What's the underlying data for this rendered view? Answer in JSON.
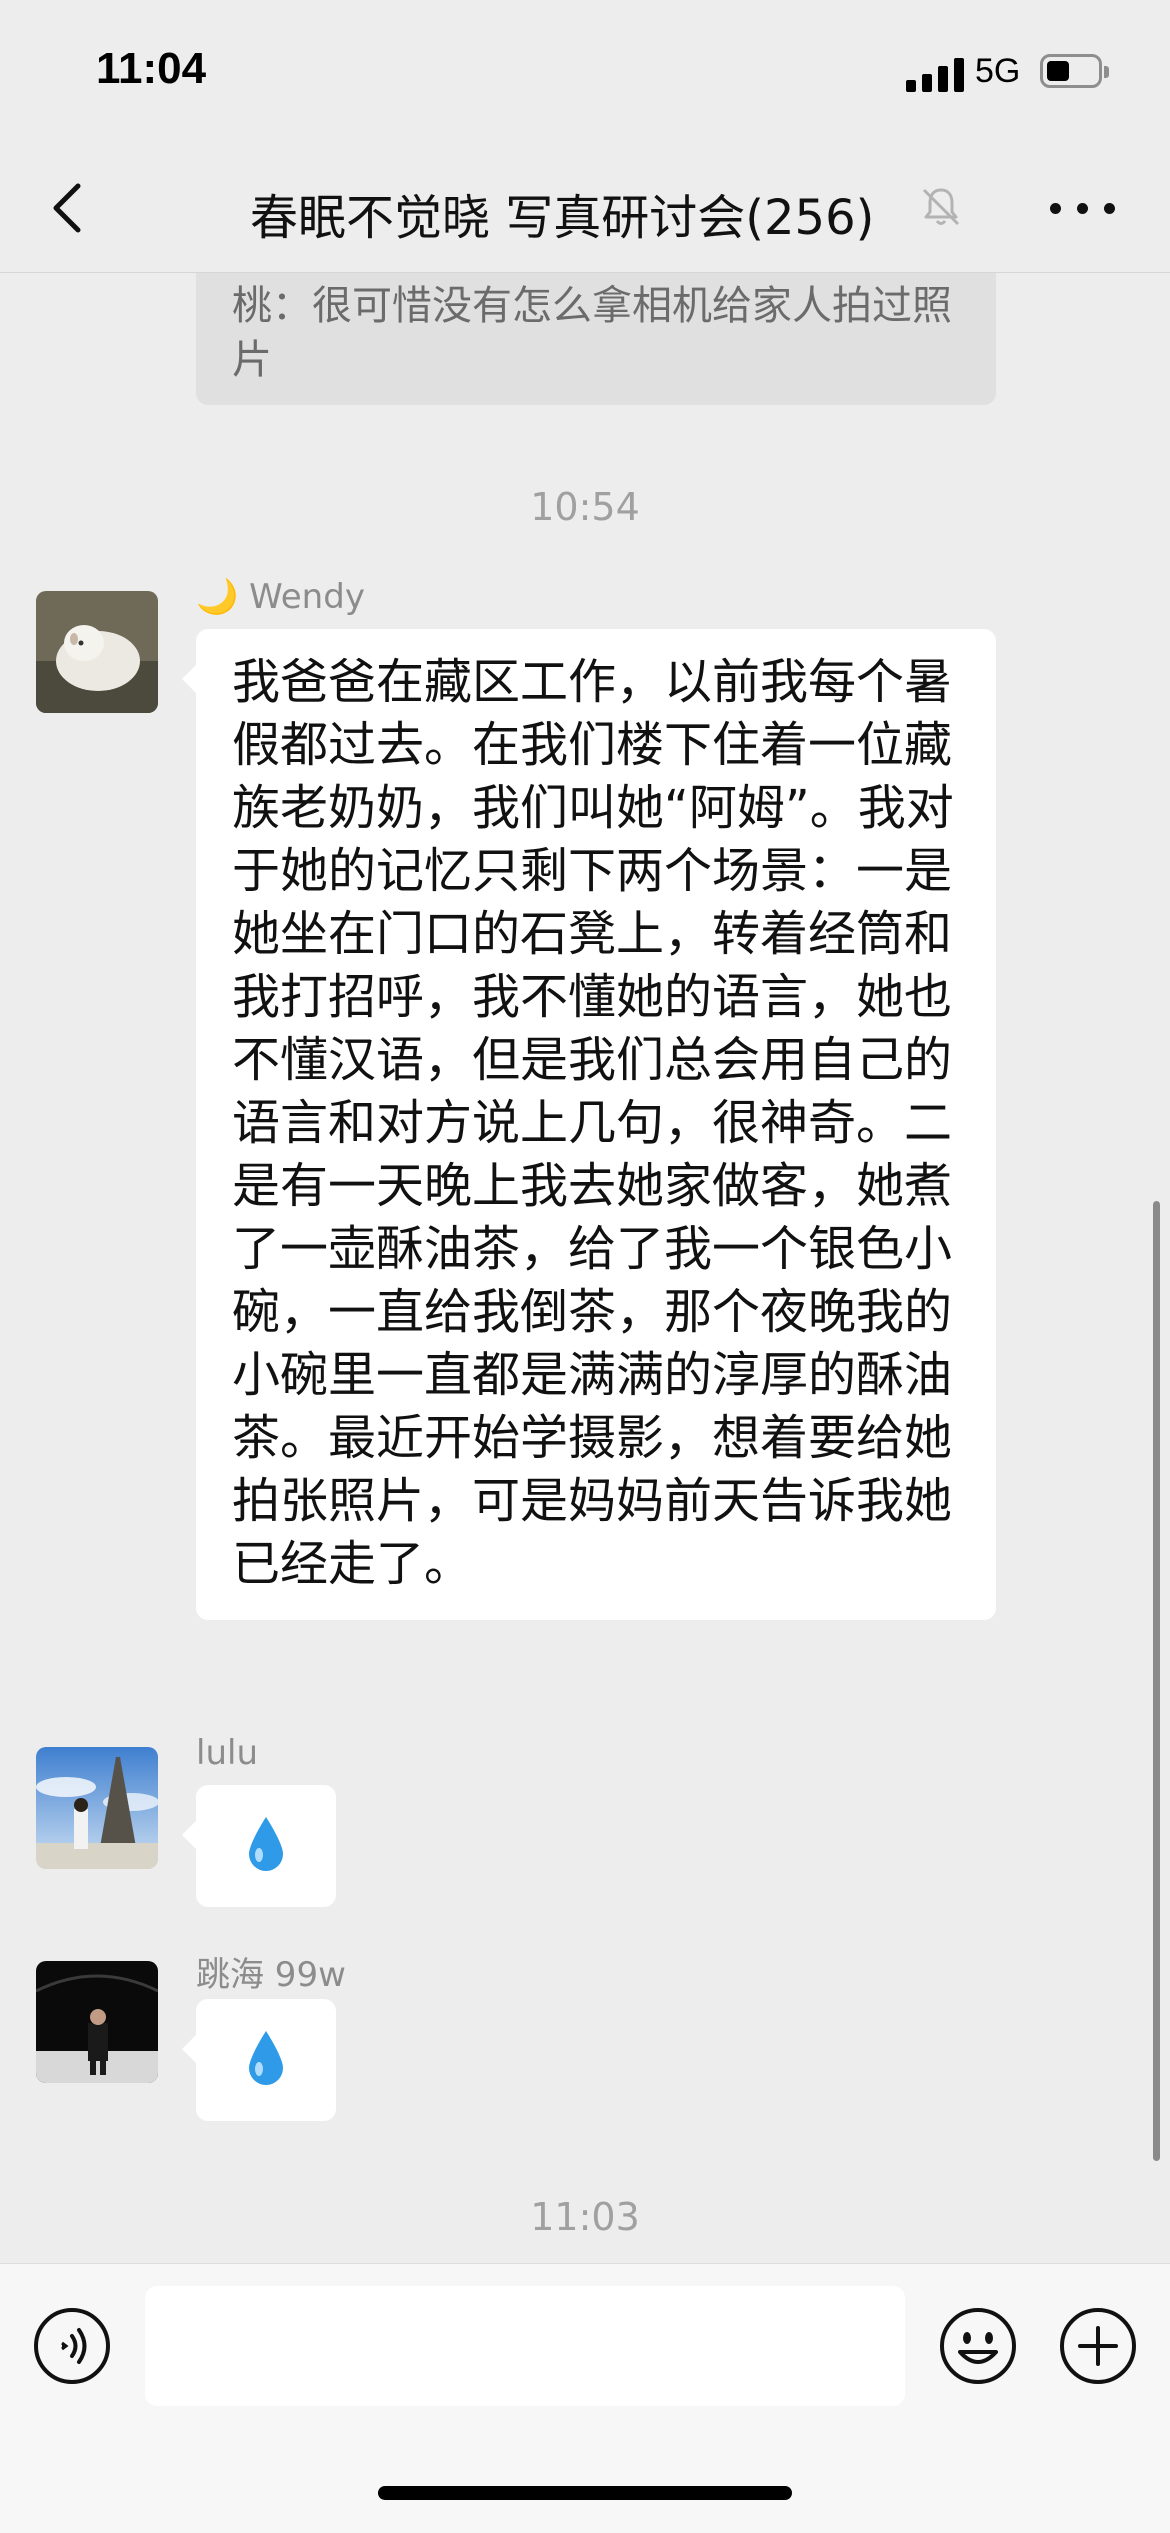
{
  "status_bar": {
    "time": "11:04",
    "network": "5G",
    "icons": [
      "signal-icon",
      "battery-icon"
    ]
  },
  "header": {
    "title": "春眠不觉晓 写真研讨会(256)",
    "icons": [
      "back-icon",
      "mute-bell-icon",
      "more-icon"
    ]
  },
  "previous_message": {
    "text": "桃：很可惜没有怎么拿相机给家人拍过照片"
  },
  "timestamps": [
    "10:54",
    "11:03"
  ],
  "messages": [
    {
      "sender": "🌙 Wendy",
      "type": "text",
      "text": "我爸爸在藏区工作，以前我每个暑假都过去。在我们楼下住着一位藏族老奶奶，我们叫她“阿姆”。我对于她的记忆只剩下两个场景：一是她坐在门口的石凳上，转着经筒和我打招呼，我不懂她的语言，她也不懂汉语，但是我们总会用自己的语言和对方说上几句，很神奇。二是有一天晚上我去她家做客，她煮了一壶酥油茶，给了我一个银色小碗，一直给我倒茶，那个夜晚我的小碗里一直都是满满的淳厚的酥油茶。最近开始学摄影，想着要给她拍张照片，可是妈妈前天告诉我她已经走了。"
    },
    {
      "sender": "lulu",
      "type": "emoji",
      "emoji": "droplet-icon"
    },
    {
      "sender": "跳海 99w",
      "type": "emoji",
      "emoji": "droplet-icon"
    }
  ],
  "input_bar": {
    "placeholder": "",
    "icons": [
      "voice-icon",
      "emoji-icon",
      "plus-icon"
    ]
  },
  "colors": {
    "background": "#ededed",
    "bubble": "#ffffff",
    "droplet": "#2f9be8"
  }
}
